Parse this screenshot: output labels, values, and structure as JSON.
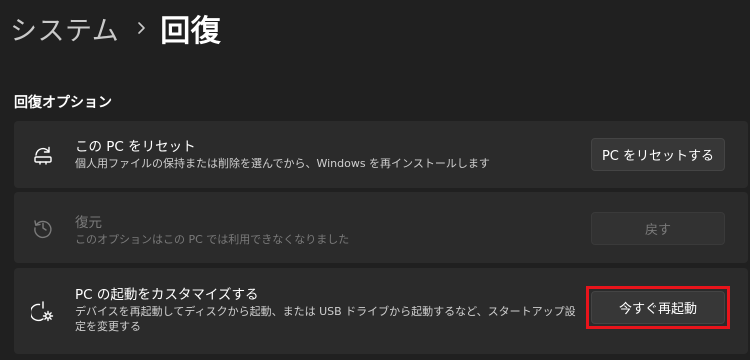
{
  "breadcrumb": {
    "parent": "システム",
    "current": "回復"
  },
  "section": {
    "title": "回復オプション"
  },
  "options": [
    {
      "title": "この PC をリセット",
      "description": "個人用ファイルの保持または削除を選んでから、Windows を再インストールします",
      "button": "PC をリセットする",
      "icon": "reset-pc-icon"
    },
    {
      "title": "復元",
      "description": "このオプションはこの PC では利用できなくなりました",
      "button": "戻す",
      "icon": "history-icon",
      "disabled": true
    },
    {
      "title": "PC の起動をカスタマイズする",
      "description": "デバイスを再起動してディスクから起動、または USB ドライブから起動するなど、スタートアップ設定を変更する",
      "button": "今すぐ再起動",
      "icon": "advanced-startup-icon",
      "highlight_color": "#e8141b"
    }
  ],
  "colors": {
    "background": "#202020",
    "card": "#2b2b2b",
    "highlight": "#e8141b"
  }
}
